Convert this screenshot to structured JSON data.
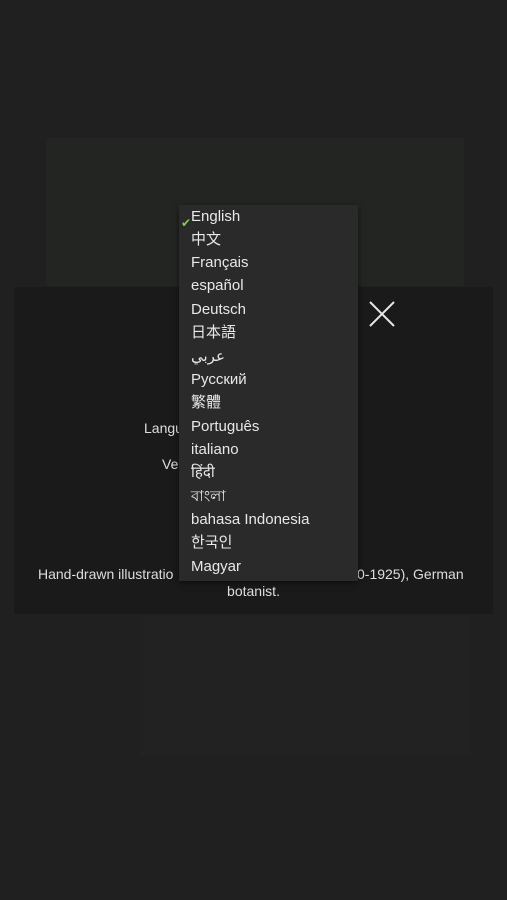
{
  "modal": {
    "language_label": "Langu",
    "version_label": "Ve",
    "caption_line1": "Hand-drawn illustration                                          0-1925), German",
    "caption_line1_left": "Hand-drawn illustratio",
    "caption_line1_right": "0-1925), German",
    "caption_line2": "botanist."
  },
  "dropdown": {
    "selected": "English",
    "options": [
      "English",
      "中文",
      "Français",
      "español",
      "Deutsch",
      "日本語",
      "عربي",
      "Русский",
      "繁體",
      "Português",
      "italiano",
      "हिंदी",
      "বাংলা",
      "bahasa Indonesia",
      "한국인",
      "Magyar"
    ]
  },
  "icons": {
    "close": "close-icon",
    "check": "check-icon"
  },
  "colors": {
    "background": "#202020",
    "modal": "#1a1a1a",
    "dropdown": "#2a2a2a",
    "check": "#7fd24a"
  }
}
